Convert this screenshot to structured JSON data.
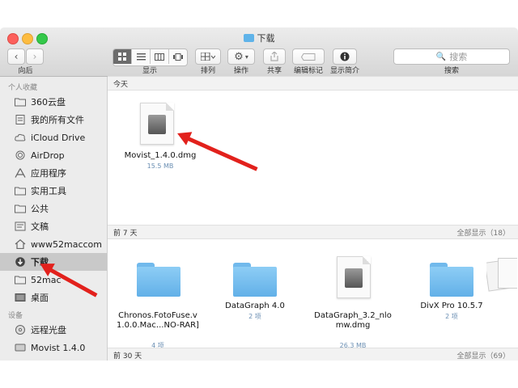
{
  "window": {
    "title": "下载"
  },
  "toolbar": {
    "back_label": "向后",
    "view_label": "显示",
    "arrange_label": "排列",
    "action_label": "操作",
    "share_label": "共享",
    "tags_label": "编辑标记",
    "info_label": "显示简介",
    "search_label": "搜索",
    "search_placeholder": "搜索"
  },
  "sidebar": {
    "favorites_title": "个人收藏",
    "items": [
      {
        "label": "360云盘",
        "icon": "folder-icon"
      },
      {
        "label": "我的所有文件",
        "icon": "all-files-icon"
      },
      {
        "label": "iCloud Drive",
        "icon": "cloud-icon"
      },
      {
        "label": "AirDrop",
        "icon": "airdrop-icon"
      },
      {
        "label": "应用程序",
        "icon": "applications-icon"
      },
      {
        "label": "实用工具",
        "icon": "folder-icon"
      },
      {
        "label": "公共",
        "icon": "folder-icon"
      },
      {
        "label": "文稿",
        "icon": "document-icon"
      },
      {
        "label": "www52maccom",
        "icon": "home-icon"
      },
      {
        "label": "下载",
        "icon": "download-icon",
        "selected": true
      },
      {
        "label": "52mac",
        "icon": "folder-icon"
      },
      {
        "label": "桌面",
        "icon": "desktop-icon"
      }
    ],
    "devices_title": "设备",
    "devices": [
      {
        "label": "远程光盘",
        "icon": "disc-icon"
      },
      {
        "label": "Movist 1.4.0",
        "icon": "disk-icon"
      }
    ]
  },
  "sections": {
    "today": {
      "title": "今天"
    },
    "week": {
      "title": "前 7 天",
      "show_all": "全部显示（18）"
    },
    "month": {
      "title": "前 30 天",
      "show_all": "全部显示（69）"
    }
  },
  "files": {
    "today": [
      {
        "name": "Movist_1.4.0.dmg",
        "sub": "15.5 MB"
      }
    ],
    "week": [
      {
        "name": "Chronos.FotoFuse.v\n1.0.0.Mac...NO-RAR]",
        "sub": "4 项"
      },
      {
        "name": "DataGraph 4.0",
        "sub": "2 项"
      },
      {
        "name": "DataGraph_3.2_nlo\nmw.dmg",
        "sub": "26.3 MB"
      },
      {
        "name": "DivX Pro 10.5.7",
        "sub": "2 项"
      }
    ]
  },
  "colors": {
    "annotation_arrow": "#e2211c",
    "folder": "#6cb6ec"
  }
}
